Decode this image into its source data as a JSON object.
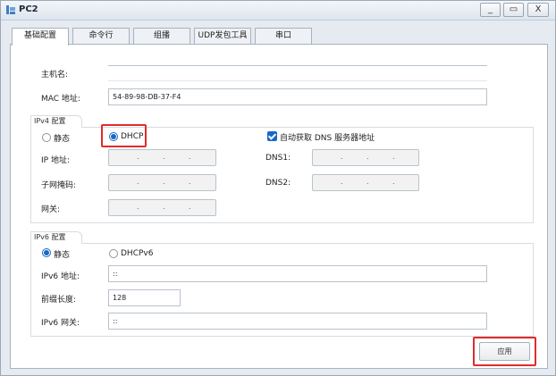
{
  "window": {
    "title": "PC2",
    "controls": {
      "minimize": "_",
      "maximize": "▭",
      "close": "X"
    }
  },
  "tabs": [
    "基础配置",
    "命令行",
    "组播",
    "UDP发包工具",
    "串口"
  ],
  "basic": {
    "hostname_label": "主机名:",
    "hostname_value": "",
    "mac_label": "MAC 地址:",
    "mac_value": "54-89-98-DB-37-F4"
  },
  "ipv4": {
    "group_title": "IPv4 配置",
    "static_label": "静态",
    "dhcp_label": "DHCP",
    "auto_dns_label": "自动获取 DNS 服务器地址",
    "ip_label": "IP 地址:",
    "mask_label": "子网掩码:",
    "gateway_label": "网关:",
    "dns1_label": "DNS1:",
    "dns2_label": "DNS2:",
    "dot": "."
  },
  "ipv6": {
    "group_title": "IPv6 配置",
    "static_label": "静态",
    "dhcpv6_label": "DHCPv6",
    "addr_label": "IPv6 地址:",
    "addr_value": "::",
    "prefix_label": "前缀长度:",
    "prefix_value": "128",
    "gateway_label": "IPv6 网关:",
    "gateway_value": "::"
  },
  "actions": {
    "apply_label": "应用"
  },
  "colors": {
    "accent": "#1769c7",
    "highlight": "#e12b2b"
  }
}
